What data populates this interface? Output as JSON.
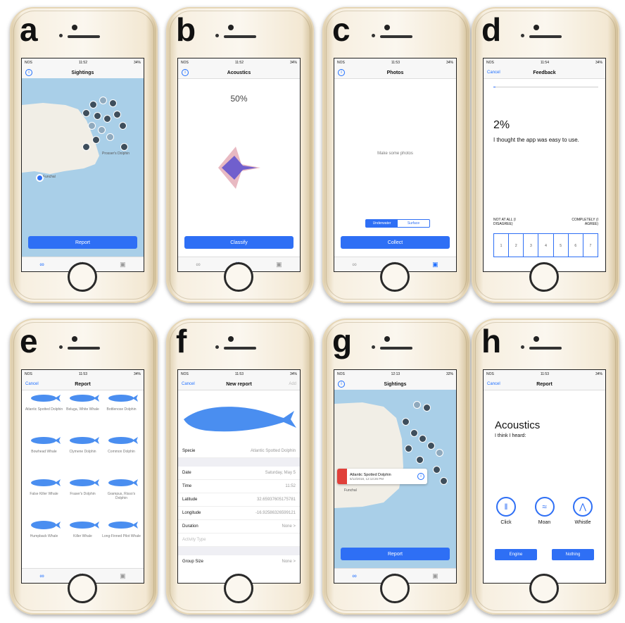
{
  "panels": {
    "a": {
      "letter": "a",
      "status": {
        "carrier": "NOS",
        "time": "11:52",
        "battery": "34%"
      },
      "title": "Sightings",
      "button": "Report",
      "map": {
        "places": [
          "Funchal",
          "Prosser's Dolphin"
        ]
      }
    },
    "b": {
      "letter": "b",
      "status": {
        "carrier": "NOS",
        "time": "11:52",
        "battery": "34%"
      },
      "title": "Acoustics",
      "percent": "50%",
      "button": "Classify"
    },
    "c": {
      "letter": "c",
      "status": {
        "carrier": "NOS",
        "time": "11:53",
        "battery": "34%"
      },
      "title": "Photos",
      "hint": "Make some photos",
      "segments": [
        "Underwater",
        "Surface"
      ],
      "button": "Collect"
    },
    "d": {
      "letter": "d",
      "status": {
        "carrier": "NOS",
        "time": "11:54",
        "battery": "34%"
      },
      "title": "Feedback",
      "cancel": "Cancel",
      "percent": "2%",
      "statement": "I thought the app was easy to use.",
      "scale_left": "NOT AT ALL (I DISAGREE)",
      "scale_right": "COMPLETELY (I AGREE)",
      "scale": [
        "1",
        "2",
        "3",
        "4",
        "5",
        "6",
        "7"
      ]
    },
    "e": {
      "letter": "e",
      "status": {
        "carrier": "NOS",
        "time": "11:53",
        "battery": "34%"
      },
      "title": "Report",
      "cancel": "Cancel",
      "species": [
        "Atlantic Spotted Dolphin",
        "Beluga, White Whale",
        "Bottlenose Dolphin",
        "Bowhead Whale",
        "Clymene Dolphin",
        "Common Dolphin",
        "False Killer Whale",
        "Fraser's Dolphin",
        "Grampus, Risso's Dolphin",
        "Humpback Whale",
        "Killer Whale",
        "Long-Finned Pilot Whale"
      ]
    },
    "f": {
      "letter": "f",
      "status": {
        "carrier": "NOS",
        "time": "11:53",
        "battery": "34%"
      },
      "title": "New report",
      "cancel": "Cancel",
      "add": "Add",
      "rows": [
        {
          "label": "Specie",
          "value": "Atlantic Spotted Dolphin"
        },
        {
          "label": "Date",
          "value": "Saturday, May 5"
        },
        {
          "label": "Time",
          "value": "11:52"
        },
        {
          "label": "Latitude",
          "value": "32.65937605175781"
        },
        {
          "label": "Longitude",
          "value": "-16.92586326599121"
        },
        {
          "label": "Duration",
          "value": "None >"
        },
        {
          "label": "Activity Type",
          "value": ""
        },
        {
          "label": "Group Size",
          "value": "None >"
        }
      ]
    },
    "g": {
      "letter": "g",
      "status": {
        "carrier": "NOS",
        "time": "12:13",
        "battery": "32%"
      },
      "title": "Sightings",
      "button": "Report",
      "callout": {
        "name": "Atlantic Spotted Dolphin",
        "date": "5/12/2018, 12:13:26 PM"
      },
      "place": "Funchal"
    },
    "h": {
      "letter": "h",
      "status": {
        "carrier": "NOS",
        "time": "11:53",
        "battery": "34%"
      },
      "title": "Report",
      "cancel": "Cancel",
      "heading": "Acoustics",
      "sub": "I think I heard:",
      "sounds": [
        "Click",
        "Moan",
        "Whistle"
      ],
      "buttons": [
        "Engine",
        "Nothing"
      ]
    }
  },
  "colors": {
    "accent": "#2e6ff5",
    "whale": "#4a8ef0",
    "map": "#a9cfe8"
  }
}
